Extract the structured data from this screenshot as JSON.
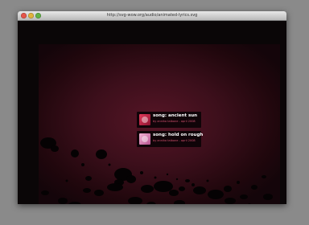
{
  "browser": {
    "url": "http://svg-wow.org/audio/animated-lyrics.svg"
  },
  "songs": [
    {
      "title": "song: ancient sun",
      "meta": "by annika talbone - april 2008",
      "thumb_color": "#c8223f"
    },
    {
      "title": "song: hold on rough",
      "meta": "by annika talbone - april 2008",
      "thumb_color": "#e790c0"
    }
  ],
  "colors": {
    "background_red": "#4a1221",
    "card_background": "#0c0306",
    "meta_text": "#d0506e"
  }
}
